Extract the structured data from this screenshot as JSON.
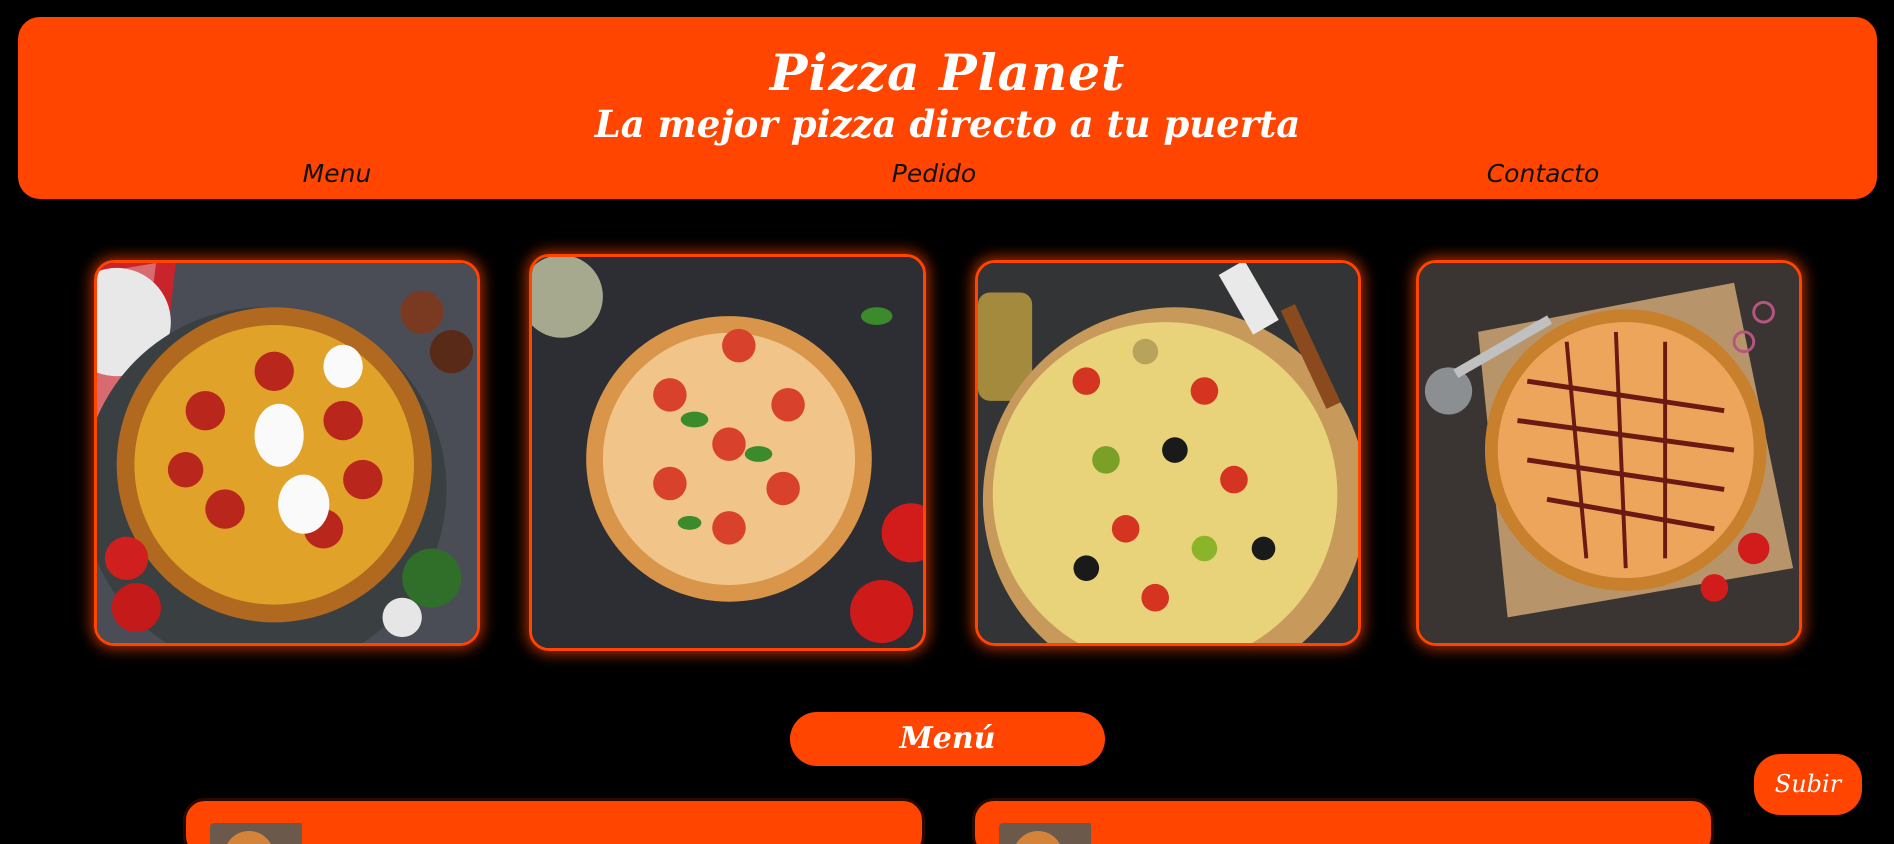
{
  "header": {
    "title": "Pizza Planet",
    "subtitle": "La mejor pizza directo a tu puerta"
  },
  "nav": {
    "items": [
      {
        "label": "Menu"
      },
      {
        "label": "Pedido"
      },
      {
        "label": "Contacto"
      }
    ]
  },
  "gallery": {
    "images": [
      {
        "alt": "pepperoni-pizza-image"
      },
      {
        "alt": "margherita-pizza-image"
      },
      {
        "alt": "vegetable-pizza-image"
      },
      {
        "alt": "bbq-pizza-image"
      }
    ]
  },
  "menu_section": {
    "heading": "Menú"
  },
  "scroll_button": {
    "label": "Subir"
  },
  "colors": {
    "accent": "#ff4500",
    "background": "#000000",
    "text": "#ffffff",
    "nav_text": "#111111"
  }
}
